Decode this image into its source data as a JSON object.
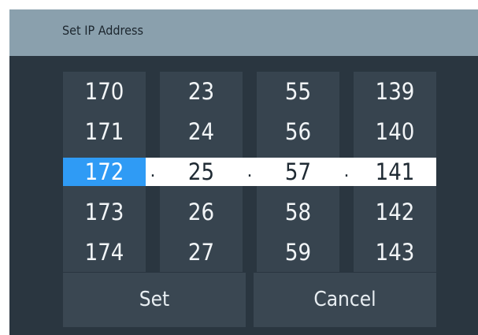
{
  "dialog": {
    "title": "Set IP Address",
    "separator": ".",
    "set_label": "Set",
    "cancel_label": "Cancel"
  },
  "octets": [
    {
      "values": [
        "170",
        "171",
        "172",
        "173",
        "174"
      ],
      "selected": "172",
      "focused": true
    },
    {
      "values": [
        "23",
        "24",
        "25",
        "26",
        "27"
      ],
      "selected": "25",
      "focused": false
    },
    {
      "values": [
        "55",
        "56",
        "57",
        "58",
        "59"
      ],
      "selected": "57",
      "focused": false
    },
    {
      "values": [
        "139",
        "140",
        "141",
        "142",
        "143"
      ],
      "selected": "141",
      "focused": false
    }
  ],
  "colors": {
    "title_bar": "#8aa0ad",
    "background": "#2a3640",
    "column": "#37444f",
    "button": "#3a4752",
    "focus_accent": "#2f9bf5",
    "selection": "#ffffff"
  }
}
